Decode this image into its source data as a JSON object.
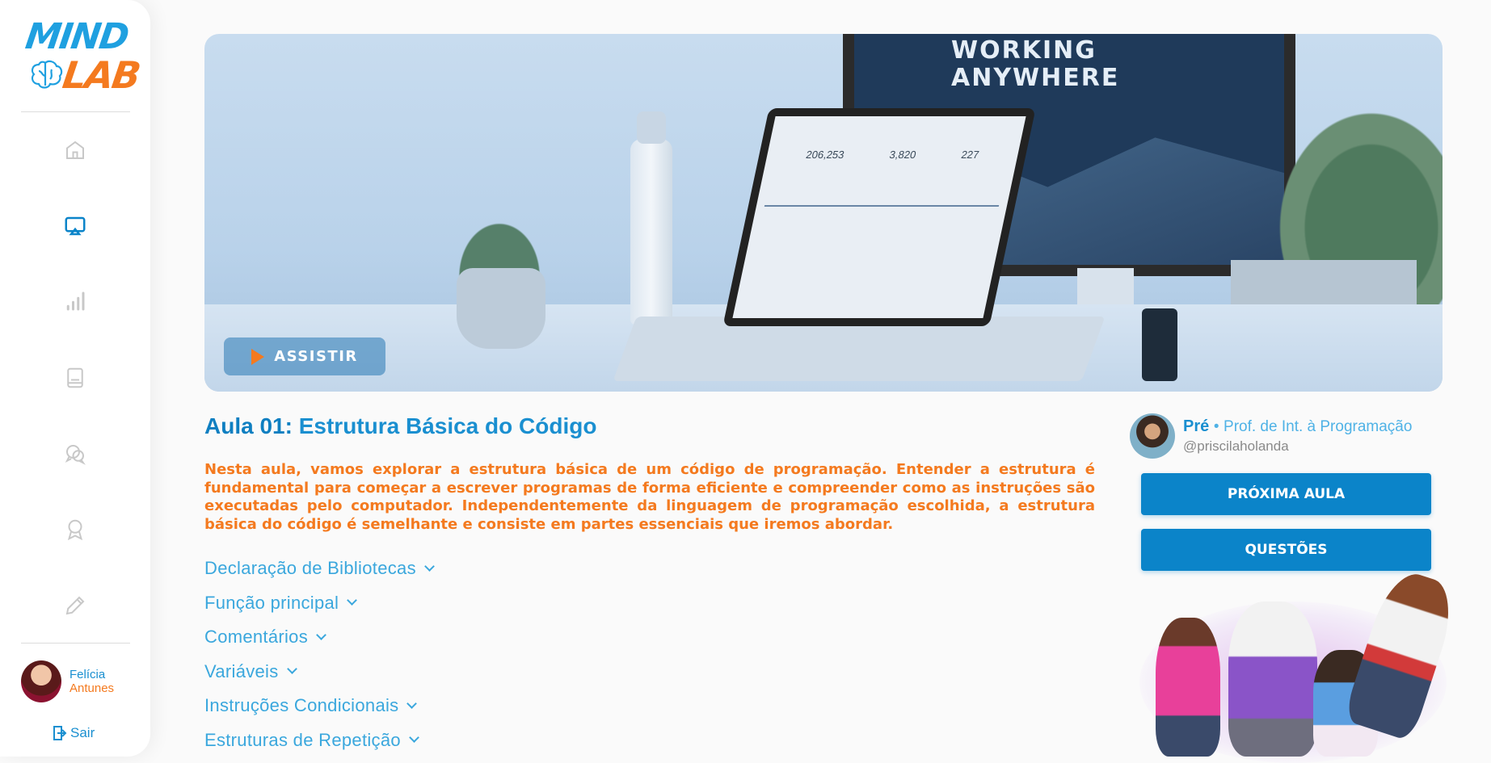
{
  "app": {
    "logo_top": "MIND",
    "logo_bottom": "LAB"
  },
  "sidebar": {
    "items": [
      {
        "name": "home",
        "icon": "home-icon",
        "active": false
      },
      {
        "name": "aulas",
        "icon": "screen-cast-icon",
        "active": true
      },
      {
        "name": "stats",
        "icon": "signal-bars-icon",
        "active": false
      },
      {
        "name": "book",
        "icon": "book-icon",
        "active": false
      },
      {
        "name": "chat",
        "icon": "chat-bubbles-icon",
        "active": false
      },
      {
        "name": "award",
        "icon": "award-icon",
        "active": false
      },
      {
        "name": "edit",
        "icon": "pencil-icon",
        "active": false
      }
    ],
    "user": {
      "first_name": "Felícia",
      "last_name": "Antunes"
    },
    "logout_label": "Sair"
  },
  "hero": {
    "watch_label": "ASSISTIR",
    "monitor_text_1": "WORKING",
    "monitor_text_2": "ANYWHERE",
    "stats": [
      "206,253",
      "3,820",
      "227"
    ]
  },
  "lesson": {
    "number_label": "Aula 01:",
    "title": "Estrutura Básica do Código",
    "description": "Nesta aula, vamos explorar a estrutura básica de um código de programação. Entender a estrutura é fundamental para começar a escrever programas de forma eficiente e compreender como as instruções são executadas pelo computador. Independentemente da linguagem de programação escolhida, a estrutura básica do código é semelhante e consiste em partes essenciais que iremos abordar.",
    "topics": [
      "Declaração de Bibliotecas",
      "Função principal",
      "Comentários",
      "Variáveis",
      "Instruções Condicionais",
      "Estruturas de Repetição"
    ]
  },
  "teacher": {
    "name": "Pré",
    "separator": "•",
    "role": "Prof. de Int. à Programação",
    "handle": "@priscilaholanda"
  },
  "actions": {
    "next_label": "PRÓXIMA AULA",
    "questions_label": "QUESTÕES"
  },
  "colors": {
    "primary": "#0b84c9",
    "accent": "#f47a1f",
    "link": "#3aa7dd",
    "icon_inactive": "#c8c8c8"
  }
}
